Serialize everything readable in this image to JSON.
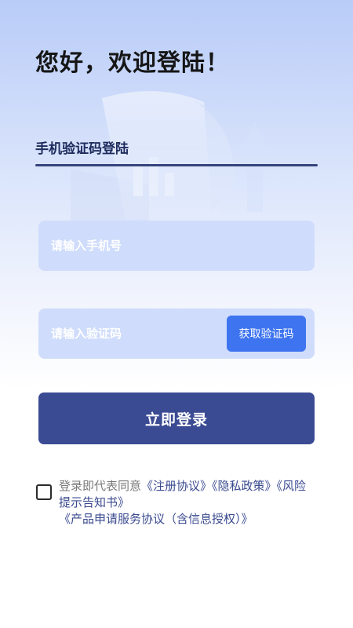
{
  "header": {
    "greeting": "您好，欢迎登陆！"
  },
  "tabs": {
    "active_label": "手机验证码登陆"
  },
  "form": {
    "phone_placeholder": "请输入手机号",
    "code_placeholder": "请输入验证码",
    "get_code_label": "获取验证码",
    "submit_label": "立即登录"
  },
  "agreement": {
    "prefix": "登录即代表同意",
    "links": [
      "《注册协议》",
      "《隐私政策》",
      "《风险提示告知书》",
      "《产品申请服务协议（含信息授权）》"
    ]
  },
  "colors": {
    "primary": "#3b4b93",
    "accent": "#3e74f0",
    "input_bg": "#cfdcfb"
  }
}
